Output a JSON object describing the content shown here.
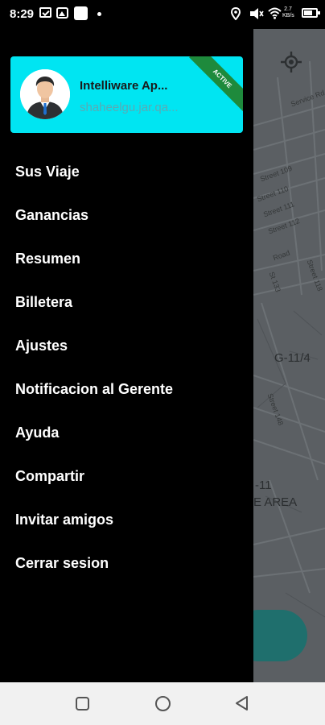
{
  "status_bar": {
    "time": "8:29",
    "net_speed_value": "2.7",
    "net_speed_unit": "KB/s",
    "icons": [
      "message-icon",
      "gallery-icon",
      "app-icon",
      "dot-icon",
      "location-icon",
      "vibrate-icon",
      "wifi-icon",
      "battery-icon"
    ]
  },
  "profile": {
    "name": "Intelliware Ap...",
    "email": "shaheelgu.jar.qa...",
    "badge": "ACTIVE",
    "colors": {
      "card": "#00e5f2",
      "badge": "#1e8a3c"
    }
  },
  "menu": {
    "items": [
      {
        "label": "Sus Viaje"
      },
      {
        "label": "Ganancias"
      },
      {
        "label": "Resumen"
      },
      {
        "label": "Billetera"
      },
      {
        "label": "Ajustes"
      },
      {
        "label": "Notificacion al Gerente"
      },
      {
        "label": "Ayuda"
      },
      {
        "label": "Compartir"
      },
      {
        "label": "Invitar amigos"
      },
      {
        "label": "Cerrar sesion"
      }
    ]
  },
  "map": {
    "streets": [
      "Street 109",
      "Street 110",
      "Street 111",
      "Street 112",
      "Street 118",
      "St 133",
      "Street 148",
      "Service Rd",
      "Road"
    ],
    "sector": "G-11/4",
    "area_number": "-11",
    "area_label": "E AREA"
  },
  "nav_bar": {
    "icons": [
      "recent-apps-icon",
      "home-icon",
      "back-icon"
    ]
  }
}
